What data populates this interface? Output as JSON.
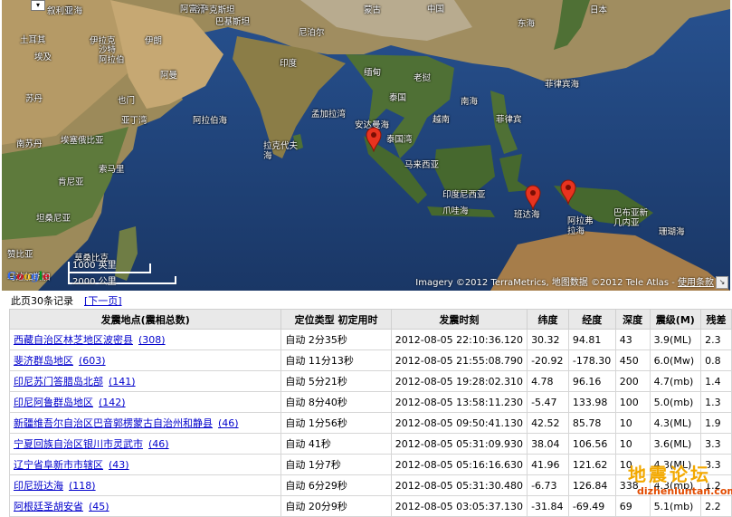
{
  "map": {
    "labels": {
      "caspian": "里海",
      "kazakhstan": "哈萨克斯坦",
      "mongolia": "蒙古",
      "turkey": "土耳其",
      "syria": "叙利亚",
      "iraq": "伊拉克",
      "iran": "伊朗",
      "afghanistan": "阿富汗",
      "pakistan": "巴基斯坦",
      "china": "中国",
      "nepal": "尼泊尔",
      "japan": "日本",
      "donghai": "东海",
      "egypt": "埃及",
      "saudi": "沙特\n阿拉伯",
      "oman": "阿曼",
      "india": "印度",
      "myanmar": "缅甸",
      "laos": "老挝",
      "philippine_sea": "菲律宾海",
      "sudan": "苏丹",
      "yemen": "也门",
      "aden": "亚丁湾",
      "thailand": "泰国",
      "south_china_sea": "南海",
      "arabian_sea": "阿拉伯海",
      "bengal": "孟加拉湾",
      "andaman": "安达曼海",
      "vietnam": "越南",
      "philippines": "菲律宾",
      "south_sudan": "南苏丹",
      "ethiopia": "埃塞俄比亚",
      "somalia": "索马里",
      "thai_gulf": "泰国湾",
      "malaysia": "马来西亚",
      "laccadive": "拉克代夫\n海",
      "kenya": "肯尼亚",
      "indonesia": "印度尼西亚",
      "java_sea": "爪哇海",
      "tanzania": "坦桑尼亚",
      "banda": "班达海",
      "arafura": "阿拉弗\n拉海",
      "papua": "巴布亚新\n几内亚",
      "coral": "珊瑚海",
      "zambia": "赞比亚",
      "mozambique": "莫桑比克",
      "madagascar": "马达加斯加"
    },
    "scale": {
      "miles": "1000 英里",
      "km": "2000 公里"
    },
    "copyright": "Imagery ©2012 TerraMetrics, 地图数据 ©2012 Tele Atlas - ",
    "terms": "使用条款",
    "google_logo": "Google",
    "marker_icon": "map-pin-icon",
    "marker_color": "#e8331f"
  },
  "pager": {
    "summary": "此页30条记录",
    "next": "[下一页]"
  },
  "table": {
    "headers": [
      "发震地点(震相总数)",
      "定位类型 初定用时",
      "发震时刻",
      "纬度",
      "经度",
      "深度",
      "震级(M)",
      "残差"
    ],
    "rows": [
      {
        "place": "西藏自治区林芝地区波密县",
        "count": "(308)",
        "loc": "自动 2分35秒",
        "time": "2012-08-05 22:10:36.120",
        "lat": "30.32",
        "lon": "94.81",
        "depth": "43",
        "mag": "3.9(ML)",
        "res": "2.3"
      },
      {
        "place": "斐济群岛地区",
        "count": "(603)",
        "loc": "自动 11分13秒",
        "time": "2012-08-05 21:55:08.790",
        "lat": "-20.92",
        "lon": "-178.30",
        "depth": "450",
        "mag": "6.0(Mw)",
        "res": "0.8"
      },
      {
        "place": "印尼苏门答腊岛北部",
        "count": "(141)",
        "loc": "自动 5分21秒",
        "time": "2012-08-05 19:28:02.310",
        "lat": "4.78",
        "lon": "96.16",
        "depth": "200",
        "mag": "4.7(mb)",
        "res": "1.4"
      },
      {
        "place": "印尼阿鲁群岛地区",
        "count": "(142)",
        "loc": "自动 8分40秒",
        "time": "2012-08-05 13:58:11.230",
        "lat": "-5.47",
        "lon": "133.98",
        "depth": "100",
        "mag": "5.0(mb)",
        "res": "1.3"
      },
      {
        "place": "新疆维吾尔自治区巴音郭楞蒙古自治州和静县",
        "count": "(46)",
        "loc": "自动 1分56秒",
        "time": "2012-08-05 09:50:41.130",
        "lat": "42.52",
        "lon": "85.78",
        "depth": "10",
        "mag": "4.3(ML)",
        "res": "1.9"
      },
      {
        "place": "宁夏回族自治区银川市灵武市",
        "count": "(46)",
        "loc": "自动 41秒",
        "time": "2012-08-05 05:31:09.930",
        "lat": "38.04",
        "lon": "106.56",
        "depth": "10",
        "mag": "3.6(ML)",
        "res": "3.3"
      },
      {
        "place": "辽宁省阜新市市辖区",
        "count": "(43)",
        "loc": "自动 1分7秒",
        "time": "2012-08-05 05:16:16.630",
        "lat": "41.96",
        "lon": "121.62",
        "depth": "10",
        "mag": "4.3(ML)",
        "res": "3.3"
      },
      {
        "place": "印尼班达海",
        "count": "(118)",
        "loc": "自动 6分29秒",
        "time": "2012-08-05 05:31:30.480",
        "lat": "-6.73",
        "lon": "126.84",
        "depth": "338",
        "mag": "4.3(mb)",
        "res": "1.2"
      },
      {
        "place": "阿根廷圣胡安省",
        "count": "(45)",
        "loc": "自动 20分9秒",
        "time": "2012-08-05 03:05:37.130",
        "lat": "-31.84",
        "lon": "-69.49",
        "depth": "69",
        "mag": "5.1(mb)",
        "res": "2.2"
      }
    ]
  },
  "watermark": {
    "cn": "地震论坛",
    "en": "dizhenluntan.com"
  }
}
